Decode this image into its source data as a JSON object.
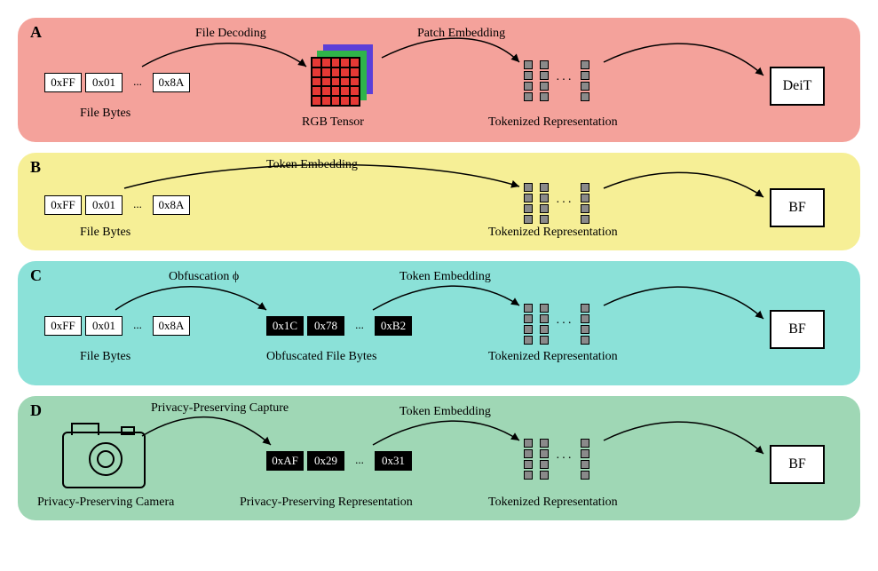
{
  "panels": {
    "A": {
      "label": "A",
      "steps": [
        "File Decoding",
        "Patch Embedding"
      ],
      "captions": [
        "File Bytes",
        "RGB Tensor",
        "Tokenized Representation"
      ],
      "bytes": [
        "0xFF",
        "0x01",
        "...",
        "0x8A"
      ],
      "model": "DeiT"
    },
    "B": {
      "label": "B",
      "steps": [
        "Token Embedding"
      ],
      "captions": [
        "File Bytes",
        "Tokenized Representation"
      ],
      "bytes": [
        "0xFF",
        "0x01",
        "...",
        "0x8A"
      ],
      "model": "BF"
    },
    "C": {
      "label": "C",
      "steps": [
        "Obfuscation ϕ",
        "Token Embedding"
      ],
      "captions": [
        "File Bytes",
        "Obfuscated File Bytes",
        "Tokenized Representation"
      ],
      "bytes": [
        "0xFF",
        "0x01",
        "...",
        "0x8A"
      ],
      "obf_bytes": [
        "0x1C",
        "0x78",
        "...",
        "0xB2"
      ],
      "model": "BF"
    },
    "D": {
      "label": "D",
      "steps": [
        "Privacy-Preserving Capture",
        "Token Embedding"
      ],
      "captions": [
        "Privacy-Preserving Camera",
        "Privacy-Preserving Representation",
        "Tokenized Representation"
      ],
      "priv_bytes": [
        "0xAF",
        "0x29",
        "...",
        "0x31"
      ],
      "model": "BF"
    }
  }
}
